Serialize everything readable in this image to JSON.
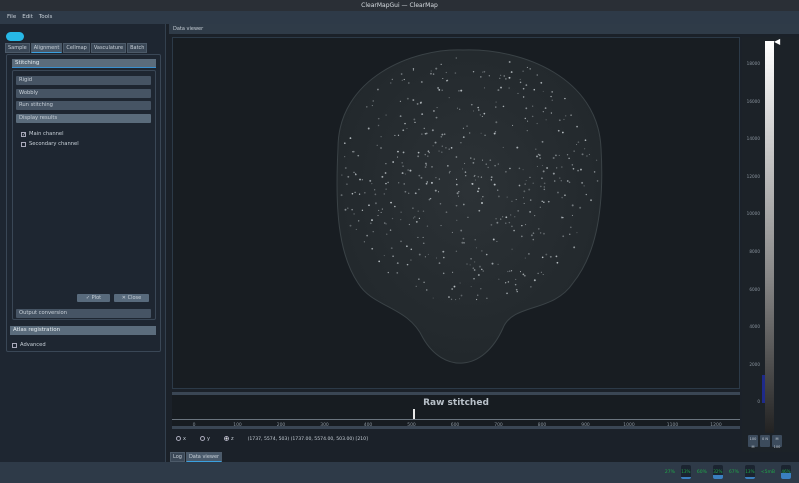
{
  "window": {
    "title": "ClearMapGui — ClearMap"
  },
  "menu": [
    "File",
    "Edit",
    "Tools"
  ],
  "tabs": [
    "Sample",
    "Alignment",
    "Cellmap",
    "Vasculature",
    "Batch"
  ],
  "stitching": {
    "header": "Stitching",
    "buttons": [
      "Rigid",
      "Wobbly",
      "Run stitching",
      "Display results"
    ],
    "main_channel": "Main channel",
    "secondary_channel": "Secondary channel",
    "plot": "Plot",
    "close": "Close",
    "output_conversion": "Output conversion"
  },
  "atlas": {
    "header": "Atlas registration",
    "advanced": "Advanced"
  },
  "viewer": {
    "header": "Data viewer",
    "title": "Raw stitched",
    "slider_value": 503,
    "ticks": [
      "0",
      "100",
      "200",
      "300",
      "400",
      "500",
      "600",
      "700",
      "800",
      "900",
      "1000",
      "1100",
      "1200"
    ],
    "axes": [
      "x",
      "y",
      "z"
    ],
    "selected_axis": "z",
    "coords": "(1737, 5574, 503) (1737.00, 5574.00, 503.00) [210]"
  },
  "histogram": {
    "ticks": [
      "18000",
      "16000",
      "14000",
      "12000",
      "10000",
      "8000",
      "6000",
      "4000",
      "2000",
      "0"
    ],
    "buttons": [
      "100 M",
      "0 N",
      "M 100"
    ]
  },
  "bottom_tabs": [
    "Log",
    "Data viewer"
  ],
  "status": {
    "items": [
      "27%",
      "13%",
      "60%",
      "32%",
      "67%",
      "13%",
      "<5mB",
      "46%"
    ]
  }
}
